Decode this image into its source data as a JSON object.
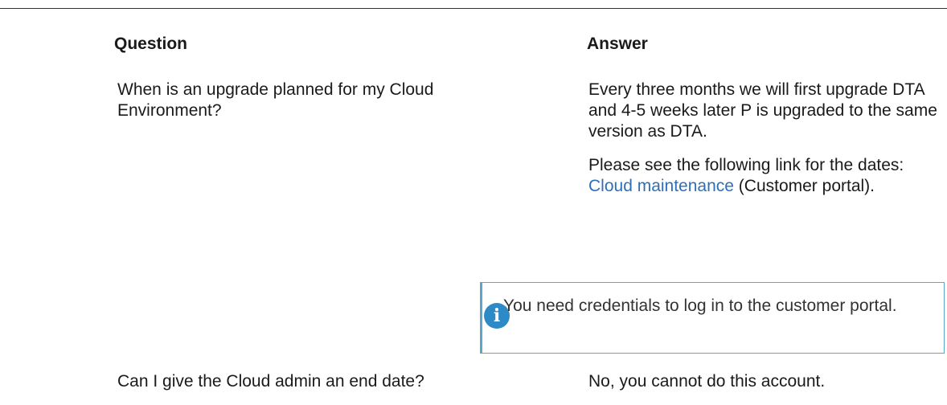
{
  "table": {
    "headers": {
      "question": "Question",
      "answer": "Answer"
    },
    "rows": [
      {
        "question": "When is an upgrade planned for my Cloud Environment?",
        "answer_paragraph_1": "Every three months we will first upgrade DTA and 4-5 weeks later P is upgraded to the same version as DTA.",
        "answer_paragraph_2_before": "Please see the following link for the dates: ",
        "answer_paragraph_2_link": "Cloud maintenance",
        "answer_paragraph_2_after": " (Customer portal).",
        "note": {
          "icon": "info-icon",
          "icon_glyph": "i",
          "text": "You need credentials to log in to the customer portal.",
          "border_color": "#5aa6cf",
          "icon_color": "#2e8ac6"
        }
      },
      {
        "question": "Can I give the Cloud admin an end date?",
        "answer": "No, you cannot do this account."
      }
    ]
  },
  "colors": {
    "link": "#2f6fb8",
    "text": "#1a1a1a"
  }
}
